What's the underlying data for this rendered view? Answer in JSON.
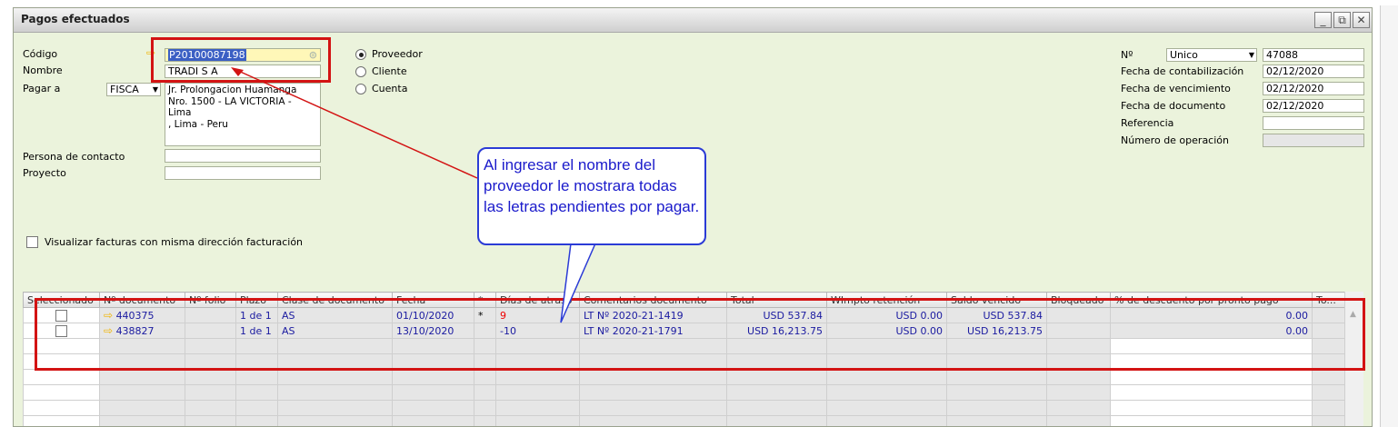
{
  "window": {
    "title": "Pagos efectuados",
    "minimize": "_",
    "restore": "⧉",
    "close": "✕"
  },
  "header": {
    "codigo_label": "Código",
    "codigo_value": "P20100087198",
    "nombre_label": "Nombre",
    "nombre_value": "TRADI S A",
    "pagar_a_label": "Pagar a",
    "pagar_a_value": "FISCA",
    "address": "Jr. Prolongacion Huamanga\nNro. 1500 - LA VICTORIA -\nLima\n, Lima - Peru",
    "contacto_label": "Persona de contacto",
    "contacto_value": "",
    "proyecto_label": "Proyecto",
    "proyecto_value": "",
    "radios": {
      "proveedor": "Proveedor",
      "cliente": "Cliente",
      "cuenta": "Cuenta"
    },
    "visualizar_label": "Visualizar facturas con misma dirección facturación"
  },
  "right": {
    "numero_label": "Nº",
    "serie_value": "Unico",
    "numero_value": "47088",
    "fecha_contab_label": "Fecha de contabilización",
    "fecha_contab_value": "02/12/2020",
    "fecha_venc_label": "Fecha de vencimiento",
    "fecha_venc_value": "02/12/2020",
    "fecha_doc_label": "Fecha de documento",
    "fecha_doc_value": "02/12/2020",
    "referencia_label": "Referencia",
    "referencia_value": "",
    "operacion_label": "Número de operación",
    "operacion_value": ""
  },
  "table": {
    "columns": [
      "Seleccionado",
      "Nº documento",
      "Nº folio",
      "Plazo",
      "Clase de documento",
      "Fecha",
      "*",
      "Días de atraso",
      "Comentarios documento",
      "Total",
      "WImpto retención",
      "Saldo vencido",
      "Bloqueado",
      "% de descuento por pronto pago",
      "To..."
    ],
    "rows": [
      {
        "doc": "440375",
        "folio": "",
        "plazo": "1 de 1",
        "clase": "AS",
        "fecha": "01/10/2020",
        "star": "*",
        "dias": "9",
        "comentario": "LT Nº 2020-21-1419",
        "total": "USD 537.84",
        "wimpto": "USD 0.00",
        "saldo": "USD 537.84",
        "bloq": "",
        "desc": "0.00"
      },
      {
        "doc": "438827",
        "folio": "",
        "plazo": "1 de 1",
        "clase": "AS",
        "fecha": "13/10/2020",
        "star": "",
        "dias": "-10",
        "comentario": "LT Nº 2020-21-1791",
        "total": "USD 16,213.75",
        "wimpto": "USD 0.00",
        "saldo": "USD 16,213.75",
        "bloq": "",
        "desc": "0.00"
      }
    ]
  },
  "callout": {
    "text": "Al ingresar el nombre del proveedor le mostrara todas las letras pendientes por pagar."
  },
  "colors": {
    "highlight": "#d31313",
    "callout": "#2b3bd6",
    "background": "#ebf3dc"
  }
}
